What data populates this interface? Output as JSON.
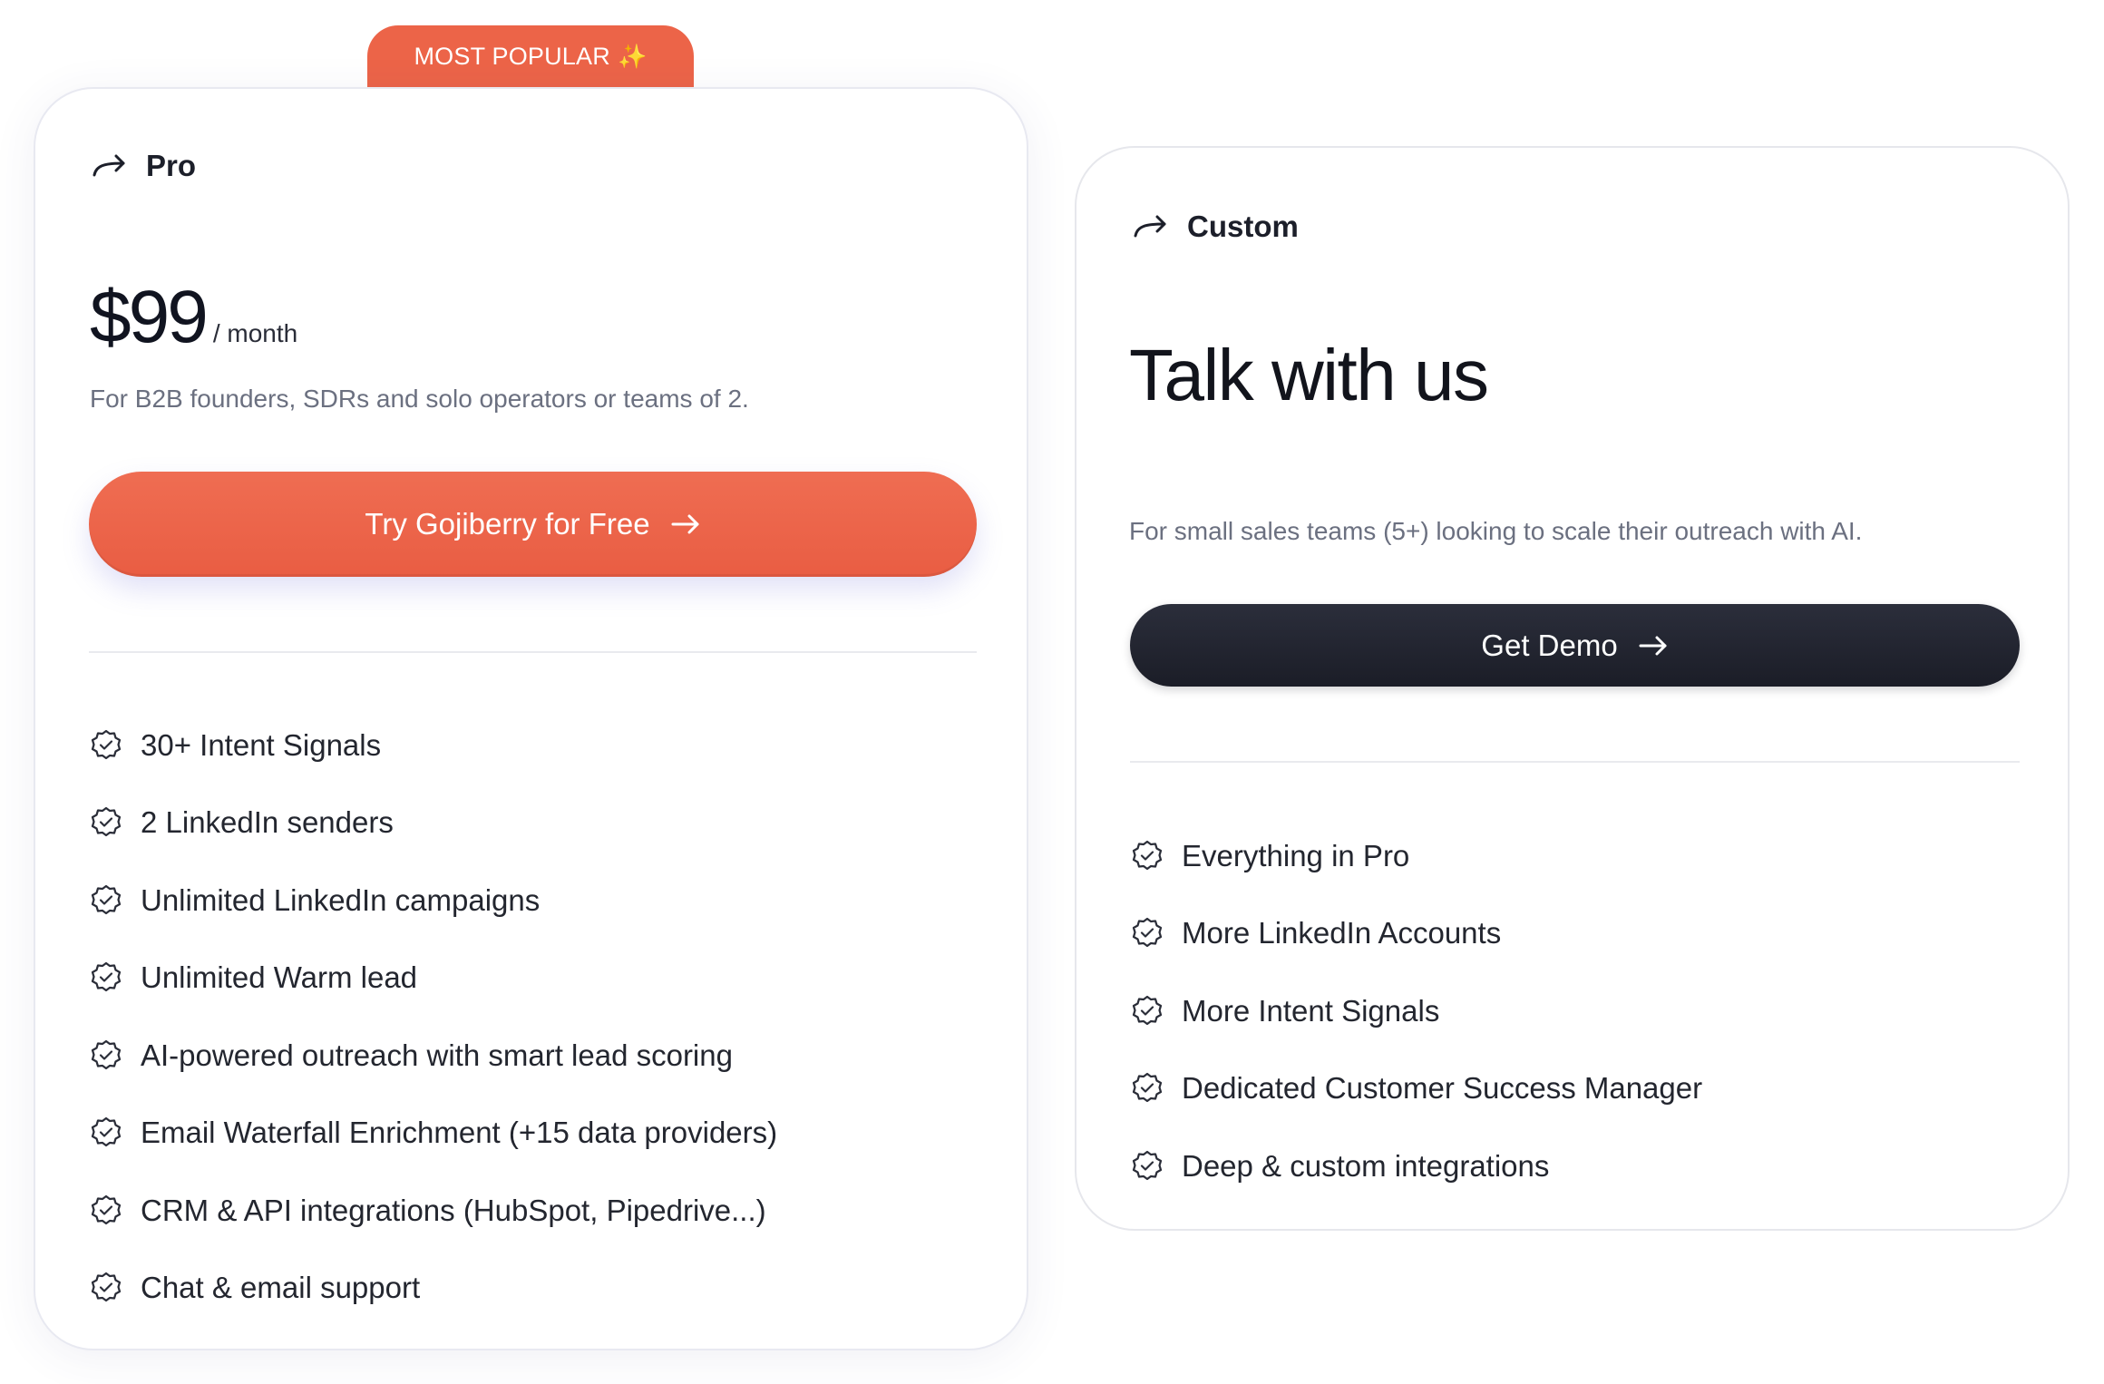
{
  "badge": {
    "label": "MOST POPULAR",
    "icon": "sparkle-icon"
  },
  "pro": {
    "name": "Pro",
    "price": "$99",
    "period": "/ month",
    "description": "For B2B founders, SDRs and solo operators or teams of 2.",
    "cta": "Try Gojiberry for Free",
    "features": [
      "30+ Intent Signals",
      "2 LinkedIn senders",
      "Unlimited LinkedIn campaigns",
      "Unlimited Warm lead",
      "AI-powered outreach with smart lead scoring",
      "Email Waterfall Enrichment (+15 data providers)",
      "CRM & API integrations (HubSpot, Pipedrive...)",
      "Chat & email support"
    ]
  },
  "custom": {
    "name": "Custom",
    "headline": "Talk with us",
    "description": "For small sales teams (5+) looking to scale their outreach with AI.",
    "cta": "Get Demo",
    "features": [
      "Everything in Pro",
      "More LinkedIn Accounts",
      "More Intent Signals",
      "Dedicated Customer Success Manager",
      "Deep & custom integrations"
    ]
  },
  "colors": {
    "accent": "#ec6448",
    "dark": "#1f2130",
    "muted": "#6b7080"
  }
}
